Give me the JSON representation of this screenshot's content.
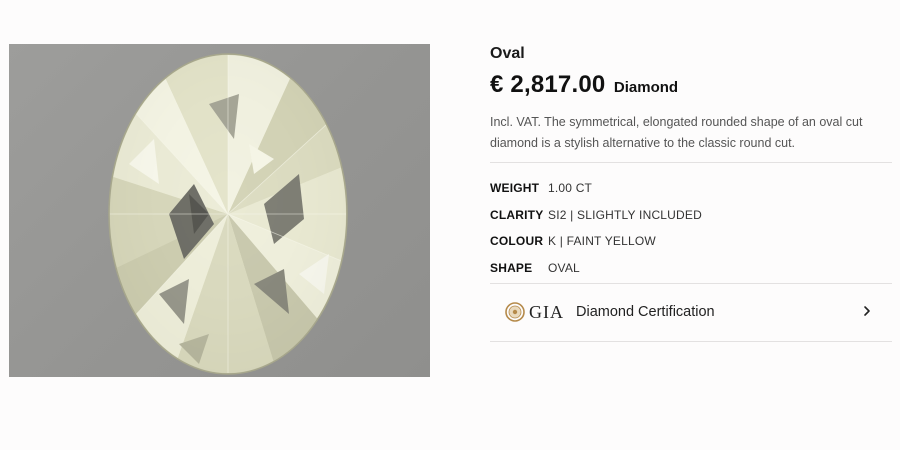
{
  "product": {
    "shape_title": "Oval",
    "price": "€ 2,817.00",
    "product_type": "Diamond",
    "description": "Incl. VAT. The symmetrical, elongated rounded shape of an oval cut diamond is a stylish alternative to the classic round cut."
  },
  "specs": [
    {
      "key": "WEIGHT",
      "value": "1.00 CT"
    },
    {
      "key": "CLARITY",
      "value": "SI2 | SLIGHTLY INCLUDED"
    },
    {
      "key": "COLOUR",
      "value": "K | FAINT YELLOW"
    },
    {
      "key": "SHAPE",
      "value": "OVAL"
    }
  ],
  "certification": {
    "logo_text": "GIA",
    "label": "Diamond Certification",
    "seal_icon": "gia-seal-icon",
    "arrow_icon": "chevron-right-icon"
  },
  "colors": {
    "photo_background": "#979795",
    "diamond_tint": "#e6e6cc",
    "accent_gold": "#b58a4a",
    "divider": "#e3e1e1"
  }
}
